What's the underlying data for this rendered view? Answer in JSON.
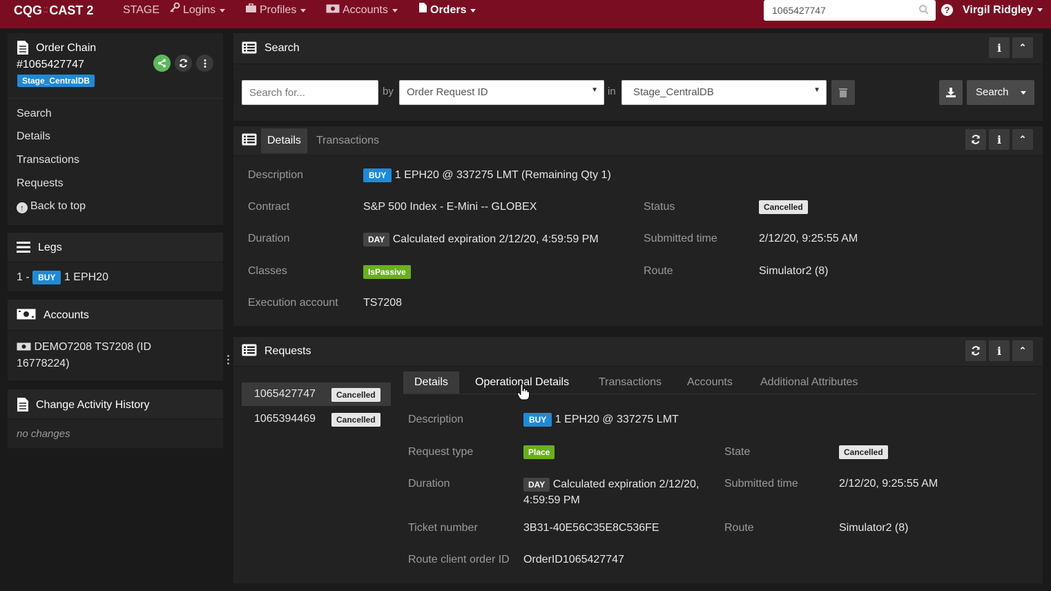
{
  "navbar": {
    "brand_a": "CQG",
    "brand_b": "CAST 2",
    "env": "STAGE",
    "logins": "Logins",
    "profiles": "Profiles",
    "accounts": "Accounts",
    "orders": "Orders",
    "search_value": "1065427747",
    "user": "Virgil Ridgley"
  },
  "sidebar": {
    "title": "Order Chain",
    "order_id": "#1065427747",
    "db_badge": "Stage_CentralDB",
    "links": [
      "Search",
      "Details",
      "Transactions",
      "Requests",
      "Back to top"
    ],
    "legs_title": "Legs",
    "leg_prefix": "1 -",
    "leg_side": "BUY",
    "leg_symbol": "1 EPH20",
    "accounts_title": "Accounts",
    "account_line1": "DEMO7208 TS7208 (ID",
    "account_line2": "16778224)",
    "history_title": "Change Activity History",
    "history_empty": "no changes"
  },
  "search_panel": {
    "title": "Search",
    "placeholder": "Search for...",
    "by_label": "by",
    "by_value": "Order Request ID",
    "in_label": "in",
    "in_value": "Stage_CentralDB",
    "search_button": "Search"
  },
  "details_panel": {
    "tab_details": "Details",
    "tab_transactions": "Transactions",
    "rows": {
      "description_label": "Description",
      "description_side": "BUY",
      "description_value": "1 EPH20 @ 337275 LMT (Remaining Qty 1)",
      "contract_label": "Contract",
      "contract_value": "S&P 500 Index - E-Mini -- GLOBEX",
      "status_label": "Status",
      "status_value": "Cancelled",
      "duration_label": "Duration",
      "duration_badge": "DAY",
      "duration_value": "Calculated expiration 2/12/20, 4:59:59 PM",
      "submitted_label": "Submitted time",
      "submitted_value": "2/12/20, 9:25:55 AM",
      "classes_label": "Classes",
      "classes_value": "IsPassive",
      "route_label": "Route",
      "route_value": "Simulator2 (8)",
      "exec_label": "Execution account",
      "exec_value": "TS7208"
    }
  },
  "requests_panel": {
    "title": "Requests",
    "list": [
      {
        "id": "1065427747",
        "status": "Cancelled"
      },
      {
        "id": "1065394469",
        "status": "Cancelled"
      }
    ],
    "tabs": [
      "Details",
      "Operational Details",
      "Transactions",
      "Accounts",
      "Additional Attributes"
    ],
    "rows": {
      "description_label": "Description",
      "description_side": "BUY",
      "description_value": "1 EPH20 @ 337275 LMT",
      "request_type_label": "Request type",
      "request_type_value": "Place",
      "state_label": "State",
      "state_value": "Cancelled",
      "duration_label": "Duration",
      "duration_badge": "DAY",
      "duration_line1": "Calculated expiration 2/12/20,",
      "duration_line2": "4:59:59 PM",
      "submitted_label": "Submitted time",
      "submitted_value": "2/12/20, 9:25:55 AM",
      "ticket_label": "Ticket number",
      "ticket_value": "3B31-40E56C35E8C536FE",
      "route_label": "Route",
      "route_value": "Simulator2 (8)",
      "client_id_label": "Route client order ID",
      "client_id_value": "OrderID1065427747"
    }
  }
}
